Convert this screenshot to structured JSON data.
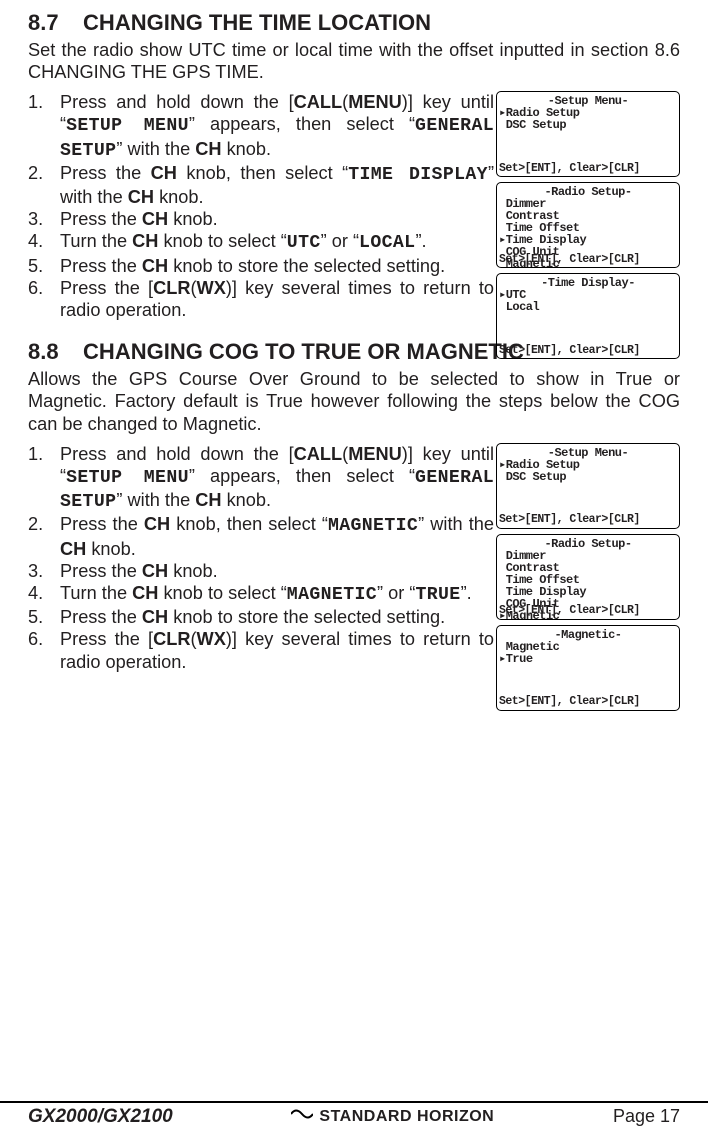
{
  "section87": {
    "heading_num": "8.7",
    "heading_title": "CHANGING THE TIME LOCATION",
    "intro": "Set the radio show UTC time or local time with the offset inputted in section 8.6 CHANGING THE GPS TIME.",
    "s1a": "Press and hold down the [",
    "s1b": "CALL",
    "s1c": "(",
    "s1d": "MENU",
    "s1e": ")] key until “",
    "s1f": "SETUP MENU",
    "s1g": "” appears, then select “",
    "s1h": "GENERAL SETUP",
    "s1i": "” with the ",
    "s1j": "CH",
    "s1k": " knob.",
    "s2a": "Press the ",
    "s2b": "CH",
    "s2c": " knob, then select “",
    "s2d": "TIME DISPLAY",
    "s2e": "” with the ",
    "s2f": "CH",
    "s2g": " knob.",
    "s3a": "Press the ",
    "s3b": "CH",
    "s3c": " knob.",
    "s4a": "Turn the ",
    "s4b": "CH",
    "s4c": " knob to select “",
    "s4d": "UTC",
    "s4e": "” or “",
    "s4f": "LOCAL",
    "s4g": "”.",
    "s5a": "Press the ",
    "s5b": "CH",
    "s5c": " knob to store the selected setting.",
    "s6a": "Press the [",
    "s6b": "CLR",
    "s6c": "(",
    "s6d": "WX",
    "s6e": ")] key several times to return to radio operation.",
    "screen1": {
      "title": "-Setup Menu-",
      "l1": "Radio Setup",
      "l2": "DSC Setup",
      "footer": "Set>[ENT], Clear>[CLR]"
    },
    "screen2": {
      "title": "-Radio Setup-",
      "l1": "Dimmer",
      "l2": "Contrast",
      "l3": "Time Offset",
      "l4": "Time Display",
      "l5": "COG Unit",
      "l6": "Magnetic",
      "footer": "Set>[ENT], Clear>[CLR]"
    },
    "screen3": {
      "title": "-Time Display-",
      "l1": "UTC",
      "l2": "Local",
      "footer": "Set>[ENT], Clear>[CLR]"
    }
  },
  "section88": {
    "heading_num": "8.8",
    "heading_title": "CHANGING COG TO TRUE OR MAGNETIC",
    "intro": "Allows the GPS Course Over Ground to be selected to show in True or Magnetic. Factory default is True however following the steps below the COG can be changed to Magnetic.",
    "s1a": "Press and hold down the [",
    "s1b": "CALL",
    "s1c": "(",
    "s1d": "MENU",
    "s1e": ")] key until “",
    "s1f": "SETUP MENU",
    "s1g": "” appears, then select “",
    "s1h": "GENERAL SETUP",
    "s1i": "” with the ",
    "s1j": "CH",
    "s1k": " knob.",
    "s2a": "Press the ",
    "s2b": "CH",
    "s2c": " knob, then select “",
    "s2d": "MAGNETIC",
    "s2e": "” with the ",
    "s2f": "CH",
    "s2g": " knob.",
    "s3a": "Press the ",
    "s3b": "CH",
    "s3c": " knob.",
    "s4a": "Turn the ",
    "s4b": "CH",
    "s4c": " knob to select “",
    "s4d": "MAGNETIC",
    "s4e": "” or “",
    "s4f": "TRUE",
    "s4g": "”.",
    "s5a": "Press the ",
    "s5b": "CH",
    "s5c": " knob to store the selected setting.",
    "s6a": "Press the [",
    "s6b": "CLR",
    "s6c": "(",
    "s6d": "WX",
    "s6e": ")] key several times to return to radio operation.",
    "screen1": {
      "title": "-Setup Menu-",
      "l1": "Radio Setup",
      "l2": "DSC Setup",
      "footer": "Set>[ENT], Clear>[CLR]"
    },
    "screen2": {
      "title": "-Radio Setup-",
      "l1": "Dimmer",
      "l2": "Contrast",
      "l3": "Time Offset",
      "l4": "Time Display",
      "l5": "COG Unit",
      "l6": "Magnetic",
      "footer": "Set>[ENT], Clear>[CLR]"
    },
    "screen3": {
      "title": "-Magnetic-",
      "l1": "Magnetic",
      "l2": "True",
      "footer": "Set>[ENT], Clear>[CLR]"
    }
  },
  "footer": {
    "model": "GX2000/GX2100",
    "brand": "STANDARD HORIZON",
    "page": "Page 17"
  }
}
